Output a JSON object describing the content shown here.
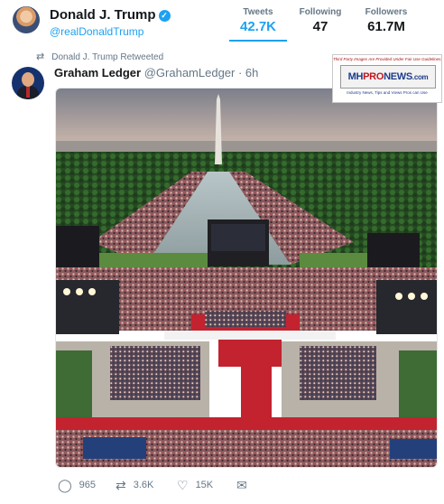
{
  "profile": {
    "name": "Donald J. Trump",
    "handle": "@realDonaldTrump",
    "verified_icon": "verified-badge-icon"
  },
  "stats": [
    {
      "label": "Tweets",
      "value": "42.7K"
    },
    {
      "label": "Following",
      "value": "47"
    },
    {
      "label": "Followers",
      "value": "61.7M"
    }
  ],
  "retweet": {
    "icon": "retweet-icon",
    "text": "Donald J. Trump Retweeted"
  },
  "tweet": {
    "author_name": "Graham Ledger",
    "author_handle": "@GrahamLedger",
    "time": "· 6h",
    "image_description_icon": "photo-media"
  },
  "watermark": {
    "note": "Third Party Images Are Provided Under Fair Use Guidelines.",
    "logo_mh": "MH",
    "logo_pro": "PRO",
    "logo_news": "NEWS",
    "logo_com": ".com",
    "tagline": "Industry News, Tips and Views Pros can Use"
  },
  "actions": [
    {
      "icon": "reply-icon",
      "glyph": "◯",
      "count": "965"
    },
    {
      "icon": "retweet-icon",
      "glyph": "⇄",
      "count": "3.6K"
    },
    {
      "icon": "heart-icon",
      "glyph": "♡",
      "count": "15K"
    },
    {
      "icon": "message-icon",
      "glyph": "✉",
      "count": ""
    }
  ],
  "colors": {
    "accent": "#1da1f2",
    "text_primary": "#14171a",
    "text_secondary": "#657786"
  }
}
